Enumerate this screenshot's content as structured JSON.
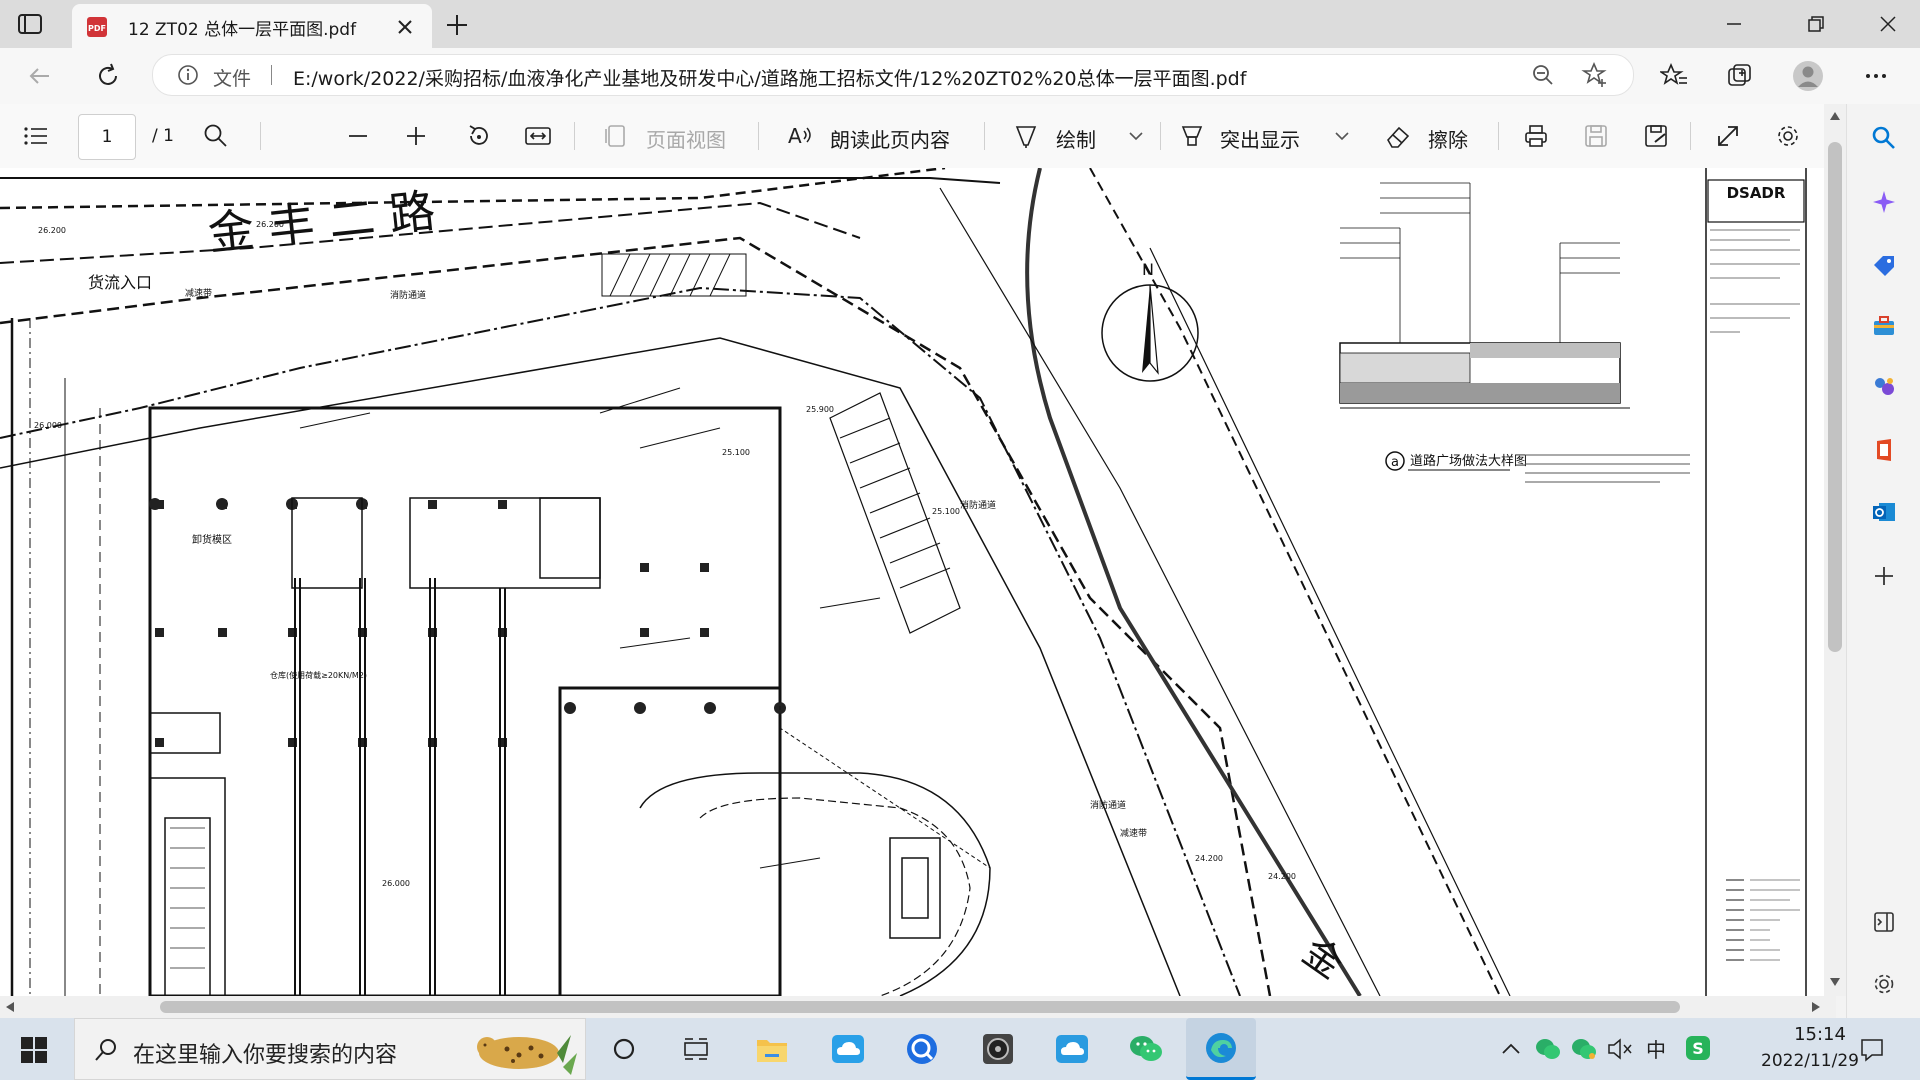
{
  "browser": {
    "tab_title": "12 ZT02 总体一层平面图.pdf",
    "url_label": "文件",
    "url": "E:/work/2022/采购招标/血液净化产业基地及研发中心/道路施工招标文件/12%20ZT02%20总体一层平面图.pdf"
  },
  "pdf_toolbar": {
    "page_current": "1",
    "page_total": "/ 1",
    "page_view_label": "页面视图",
    "read_aloud_label": "朗读此页内容",
    "draw_label": "绘制",
    "highlight_label": "突出显示",
    "erase_label": "擦除"
  },
  "drawing": {
    "road_name": "金 丰 二 路",
    "freight_entrance": "货流入口",
    "north_label": "N",
    "unloading_area": "卸货模区",
    "detail_title": "道路广场做法大样图",
    "detail_marker": "a",
    "firm_name": "DSADR",
    "road_name_2": "金",
    "elev_1": "26.200",
    "elev_2": "25.900",
    "elev_3": "26.000",
    "elev_4": "25.100",
    "elev_5": "24.200",
    "label_fire_lane": "消防通道",
    "label_speed_bump": "减速带",
    "label_warehouse": "仓库(使用荷载≥20KN/M2)"
  },
  "taskbar": {
    "search_placeholder": "在这里输入你要搜索的内容",
    "ime_label": "中",
    "time": "15:14",
    "date": "2022/11/29"
  },
  "colors": {
    "accent": "#0078d4",
    "pdf_red": "#d13438",
    "taskbar_bg": "#d9e2ec"
  }
}
